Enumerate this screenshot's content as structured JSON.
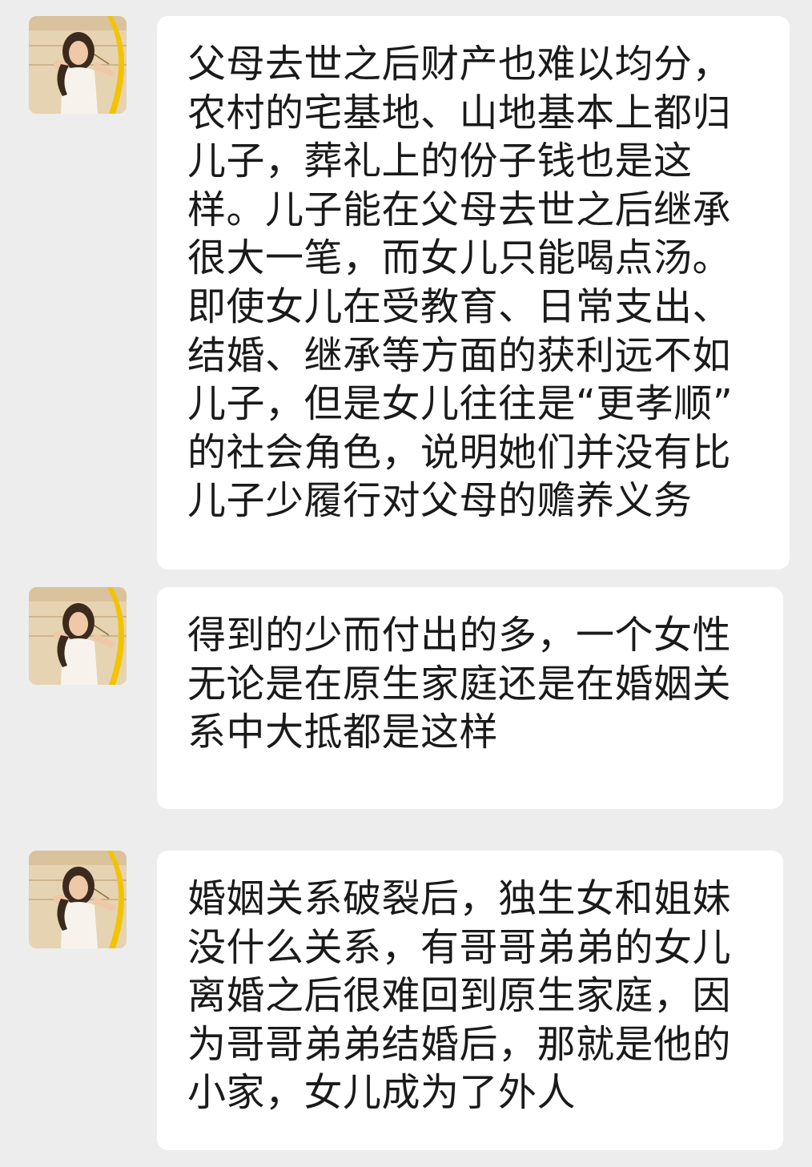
{
  "chat": {
    "messages": [
      {
        "sender_avatar": "user-avatar",
        "text": "父母去世之后财产也难以均分，\n农村的宅基地、山地基本上都归\n儿子，葬礼上的份子钱也是这\n样。儿子能在父母去世之后继承\n很大一笔，而女儿只能喝点汤。\n即使女儿在受教育、日常支出、\n结婚、继承等方面的获利远不如\n儿子，但是女儿往往是“更孝顺”\n的社会角色，说明她们并没有比\n儿子少履行对父母的赡养义务"
      },
      {
        "sender_avatar": "user-avatar",
        "text": "得到的少而付出的多，一个女性\n无论是在原生家庭还是在婚姻关\n系中大抵都是这样"
      },
      {
        "sender_avatar": "user-avatar",
        "text": "婚姻关系破裂后，独生女和姐妹\n没什么关系，有哥哥弟弟的女儿\n离婚之后很难回到原生家庭，因\n为哥哥弟弟结婚后，那就是他的\n小家，女儿成为了外人"
      }
    ]
  },
  "colors": {
    "background": "#ededed",
    "bubble": "#ffffff",
    "text": "#1a1a1a",
    "avatar_wall": "#e9d7b6",
    "avatar_bow": "#f2c400"
  }
}
